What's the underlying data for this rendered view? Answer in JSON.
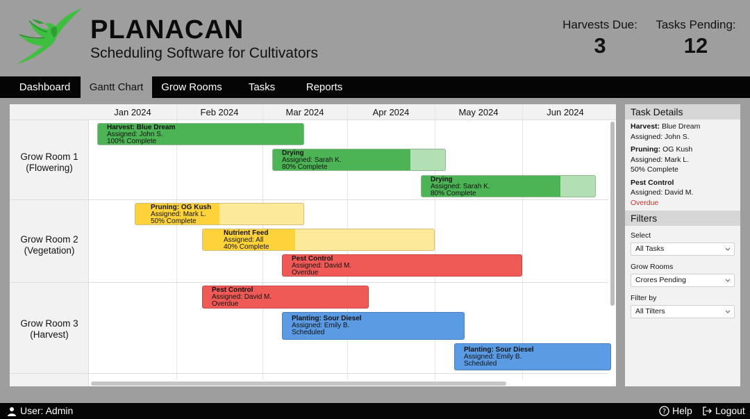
{
  "brand": {
    "name": "PLANACAN",
    "subtitle": "Scheduling Software for Cultivators"
  },
  "stats": [
    {
      "label": "Harvests Due:",
      "value": "3"
    },
    {
      "label": "Tasks Pending:",
      "value": "12"
    }
  ],
  "nav": [
    "Dashboard",
    "Gantt Chart",
    "Grow Rooms",
    "Tasks",
    "Reports"
  ],
  "nav_active": "Gantt Chart",
  "months": [
    "Jan 2024",
    "Feb 2024",
    "Mar 2024",
    "Apr 2024",
    "May 2024",
    "Jun 2024"
  ],
  "rooms": [
    {
      "line1": "Grow Room 1",
      "line2": "(Flowering)"
    },
    {
      "line1": "Grow Room 2",
      "line2": "(Vegetation)"
    },
    {
      "line1": "Grow Room 3",
      "line2": "(Harvest)"
    }
  ],
  "tasks": [
    {
      "title": "Harvest: Blue Dream",
      "assigned": "Assigned: John S.",
      "status": "100% Complete",
      "progress": 1.0
    },
    {
      "title": "Drying",
      "assigned": "Assigned: Sarah K.",
      "status": "80% Complete",
      "progress": 0.8
    },
    {
      "title": "Drying",
      "assigned": "Assigned: Sarah K.",
      "status": "80% Complete",
      "progress": 0.8
    },
    {
      "title": "Pruning: OG Kush",
      "assigned": "Assigned: Mark L.",
      "status": "50% Complete",
      "progress": 0.5
    },
    {
      "title": "Nutrient Feed",
      "assigned": "Assigned: All",
      "status": "40% Complete",
      "progress": 0.4
    },
    {
      "title": "Pest Control",
      "assigned": "Assigned: David M.",
      "status": "Overdue",
      "progress": 1.0
    },
    {
      "title": "Pest Control",
      "assigned": "Assigned: David M.",
      "status": "Overdue",
      "progress": 1.0
    },
    {
      "title": "Planting: Sour Diesel",
      "assigned": "Assigned: Emily B.",
      "status": "Scheduled",
      "progress": 1.0
    },
    {
      "title": "Planting: Sour Diesel",
      "assigned": "Assigned: Emily B.",
      "status": "Scheduled",
      "progress": 1.0
    }
  ],
  "colors": {
    "green": "#4cb454",
    "green_light": "#b2dfb4",
    "yellow": "#fdd23a",
    "yellow_light": "#fde99a",
    "red": "#ef5a57",
    "blue": "#5a9be3",
    "brand_green": "#3fbf3f",
    "overdue": "#d32f2f"
  },
  "task_details": {
    "title": "Task Details",
    "items": [
      {
        "task": "Harvest:",
        "name": " Blue Dream",
        "assigned": "Assigned: John S."
      },
      {
        "task": "Pruning:",
        "name": " OG Kush",
        "assigned": "Assigned: Mark L.",
        "status": "50% Complete"
      },
      {
        "task": "Pest Control",
        "name": "",
        "assigned": "Assigned: David M.",
        "status": "Overdue"
      }
    ]
  },
  "filters": {
    "title": "Filters",
    "groups": [
      {
        "label": "Select",
        "value": "All Tasks"
      },
      {
        "label": "Grow Rooms",
        "value": "Crores Pending"
      },
      {
        "label": "Filter by",
        "value": "All Tilters"
      }
    ]
  },
  "footer": {
    "user": "User: Admin",
    "help": "Help",
    "logout": "Logout"
  }
}
